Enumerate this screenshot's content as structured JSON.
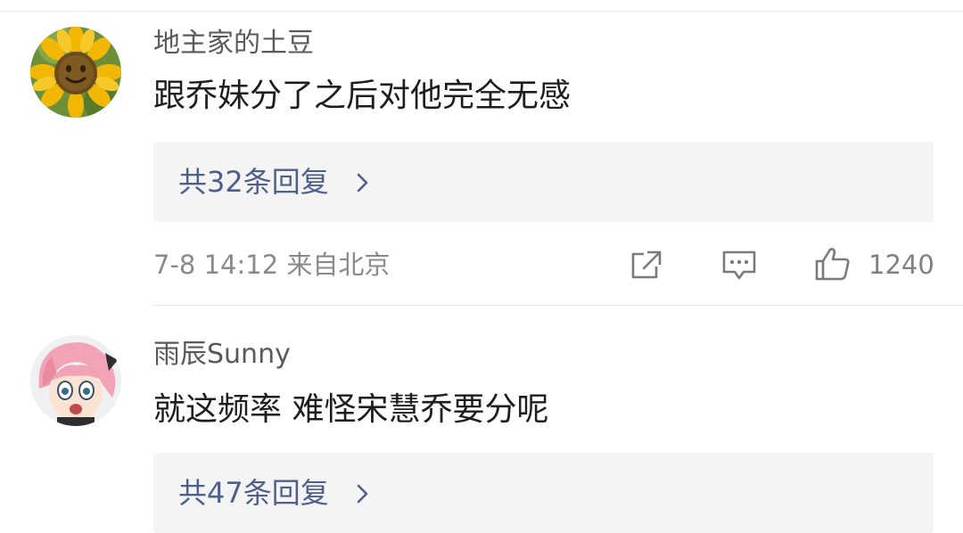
{
  "comments": [
    {
      "username": "地主家的土豆",
      "avatar": "sunflower-avatar",
      "text": "跟乔妹分了之后对他完全无感",
      "replies": "共32条回复",
      "time_location": "7-8 14:12 来自北京",
      "likes": "1240",
      "icons": [
        "share-icon",
        "comment-icon",
        "like-icon"
      ]
    },
    {
      "username": "雨辰Sunny",
      "avatar": "anime-girl-avatar",
      "text": "就这频率 难怪宋慧乔要分呢",
      "replies": "共47条回复"
    }
  ],
  "colors": {
    "link": "#4f5f8c",
    "username": "#5a5a5a",
    "content": "#1e1e1e",
    "meta": "#8a8a8a",
    "reply_bg": "#f4f4f4"
  }
}
